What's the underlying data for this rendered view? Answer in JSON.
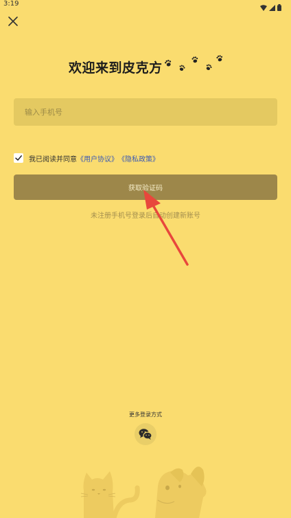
{
  "status_bar": {
    "time": "3:19"
  },
  "header": {
    "title": "欢迎来到皮克方"
  },
  "form": {
    "phone_placeholder": "输入手机号",
    "agree_text": "我已阅读并同意",
    "user_agreement": "《用户协议》",
    "privacy_policy": "《隐私政策》",
    "agreed": true,
    "get_code_label": "获取验证码",
    "hint": "未注册手机号登录后自动创建新账号"
  },
  "footer": {
    "more_login": "更多登录方式",
    "wechat_icon": "wechat-icon"
  },
  "colors": {
    "background": "#FADC6F",
    "input_bg": "#E4C961",
    "button_bg": "#9D874A",
    "link": "#3a59b5",
    "arrow": "#e8473c"
  }
}
